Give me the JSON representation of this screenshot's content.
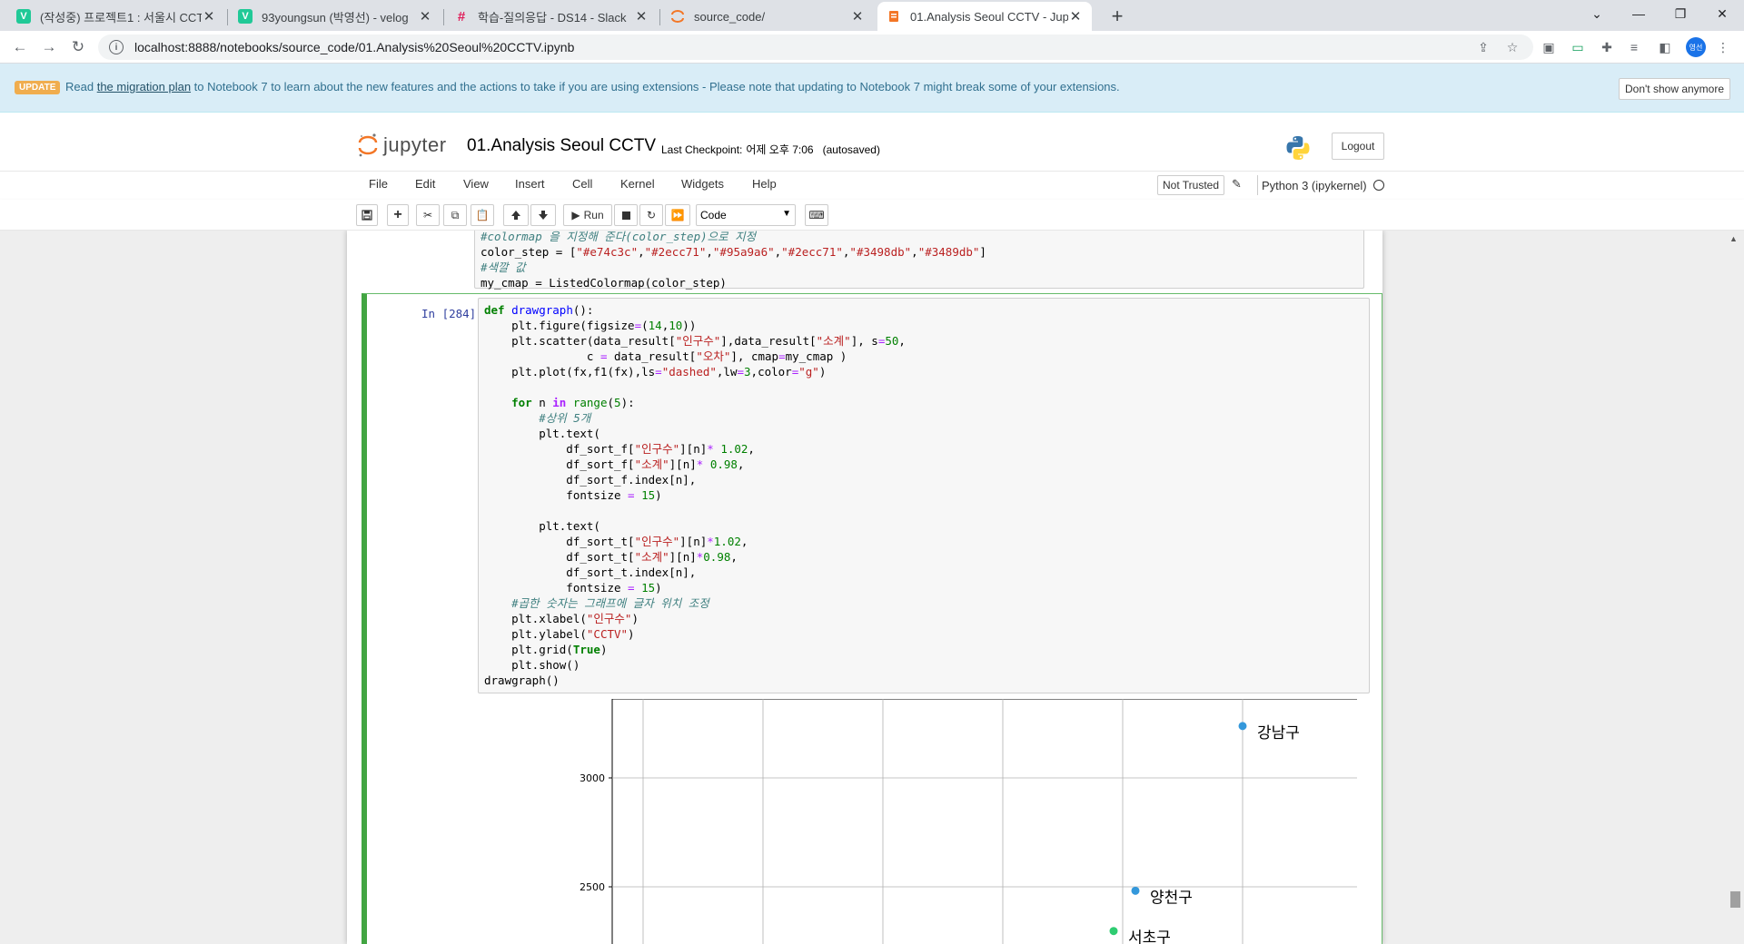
{
  "browser": {
    "tabs": [
      {
        "title": "(작성중) 프로젝트1 : 서울시 CCTV",
        "favicon": "velog-v-icon",
        "favicon_text": "V",
        "color": "#20c997",
        "active": false
      },
      {
        "title": "93youngsun (박영선) - velog",
        "favicon": "velog-v-icon",
        "favicon_text": "V",
        "color": "#20c997",
        "active": false
      },
      {
        "title": "학습-질의응답 - DS14 - Slack",
        "favicon": "slack-icon",
        "favicon_text": "#",
        "color": "#e01e5a",
        "active": false
      },
      {
        "title": "source_code/",
        "favicon": "jupyter-icon",
        "favicon_text": "",
        "color": "#f37626",
        "active": false
      },
      {
        "title": "01.Analysis Seoul CCTV - Jupyter",
        "favicon": "jupyter-icon",
        "favicon_text": "",
        "color": "#f37626",
        "active": true
      }
    ],
    "url": "localhost:8888/notebooks/source_code/01.Analysis%20Seoul%20CCTV.ipynb",
    "profile_initial": "영선",
    "profile_color": "#1a73e8"
  },
  "banner": {
    "badge": "UPDATE",
    "text_before": "Read",
    "link": "the migration plan",
    "text_after": "to Notebook 7 to learn about the new features and the actions to take if you are using extensions - Please note that updating to Notebook 7 might break some of your extensions.",
    "dismiss": "Don't show anymore"
  },
  "header": {
    "logo_text": "jupyter",
    "notebook_title": "01.Analysis Seoul CCTV",
    "checkpoint_label": "Last Checkpoint:",
    "checkpoint_value": "어제 오후 7:06",
    "save_status": "(autosaved)",
    "logout": "Logout"
  },
  "menu": {
    "items": [
      "File",
      "Edit",
      "View",
      "Insert",
      "Cell",
      "Kernel",
      "Widgets",
      "Help"
    ],
    "trusted": "Not Trusted",
    "kernel": "Python 3 (ipykernel)"
  },
  "toolbar": {
    "run_label": "Run",
    "cell_type": "Code"
  },
  "prev_cell": {
    "line1": "#colormap 을 지정해 준다(color_step)으로 지정",
    "line2_pre": "color_step = [",
    "colors": [
      "\"#e74c3c\"",
      "\"#2ecc71\"",
      "\"#95a9a6\"",
      "\"#2ecc71\"",
      "\"#3498db\"",
      "\"#3489db\""
    ],
    "line3": "#색깔 값",
    "line4": "my_cmap = ListedColormap(color_step)"
  },
  "cell": {
    "prompt": "In [284]:"
  },
  "plot": {
    "chart_data": {
      "type": "scatter",
      "yticks": [
        "3000",
        "2500"
      ],
      "points": [
        {
          "label": "강남구",
          "color": "#3498db",
          "y": 3238
        },
        {
          "label": "양천구",
          "color": "#3498db",
          "y": 2482
        },
        {
          "label": "서초구",
          "color": "#2ecc71",
          "y": 2297
        }
      ],
      "grid": true
    }
  }
}
